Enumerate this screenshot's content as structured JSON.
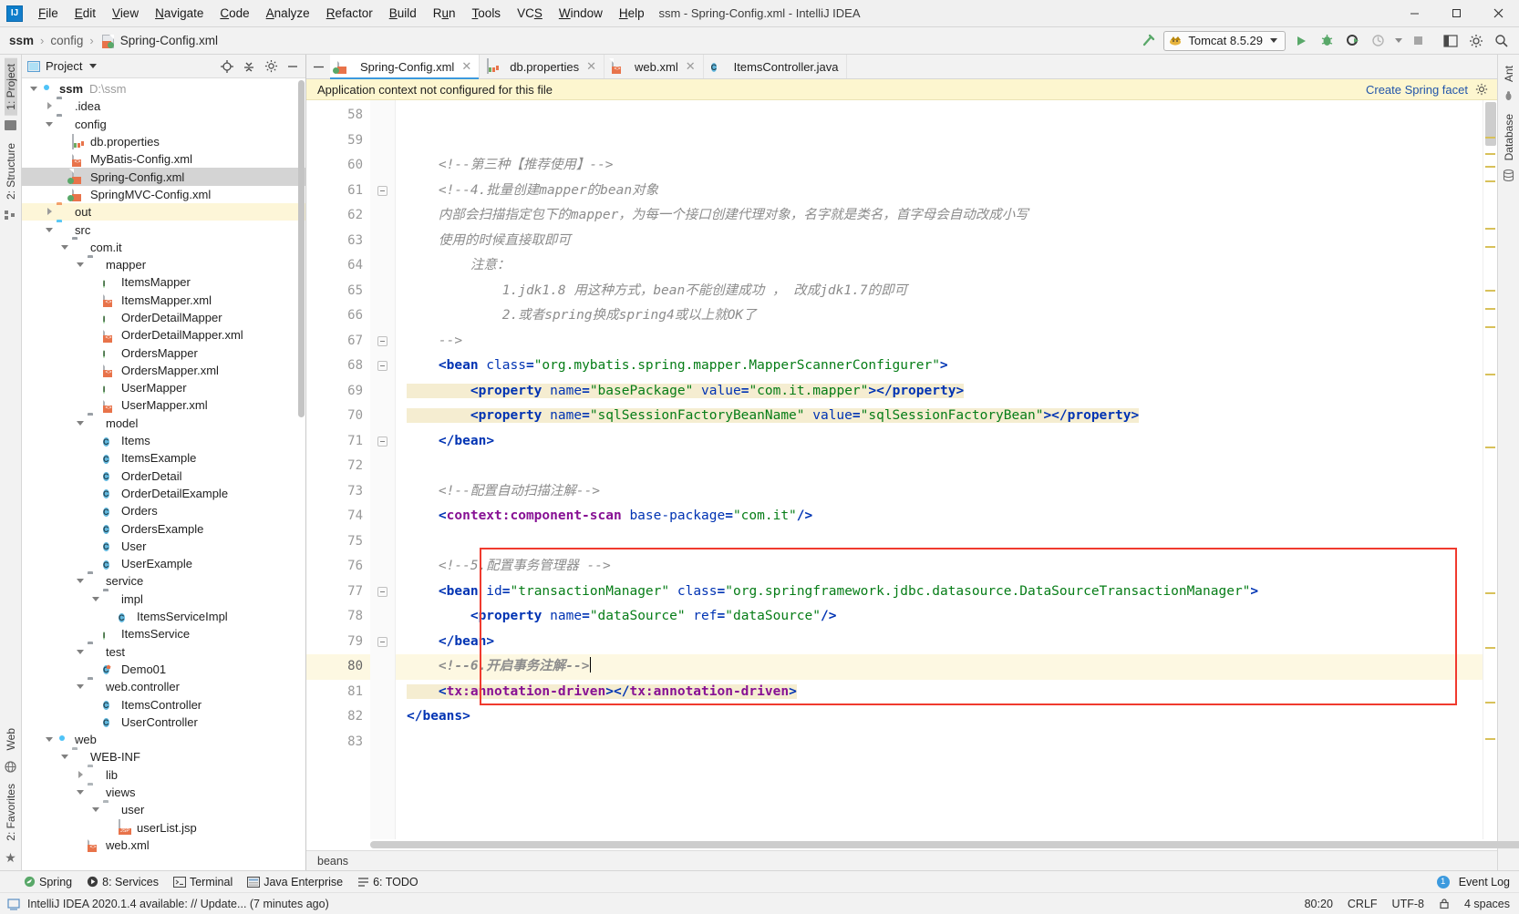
{
  "window": {
    "title": "ssm - Spring-Config.xml - IntelliJ IDEA",
    "logo": "IJ",
    "minimize_label": "─",
    "maximize_label": "☐",
    "close_label": "✕"
  },
  "menu": [
    {
      "label": "File"
    },
    {
      "label": "Edit"
    },
    {
      "label": "View"
    },
    {
      "label": "Navigate"
    },
    {
      "label": "Code"
    },
    {
      "label": "Analyze"
    },
    {
      "label": "Refactor"
    },
    {
      "label": "Build"
    },
    {
      "label": "Run"
    },
    {
      "label": "Tools"
    },
    {
      "label": "VCS"
    },
    {
      "label": "Window"
    },
    {
      "label": "Help"
    }
  ],
  "breadcrumb": {
    "project": "ssm",
    "folder": "config",
    "file": "Spring-Config.xml",
    "separator": "›"
  },
  "toolbar": {
    "build_icon": "hammer-icon",
    "run_config": "Tomcat 8.5.29",
    "run_icon": "run-icon",
    "debug_icon": "debug-icon",
    "run_coverage_icon": "run-with-coverage-icon",
    "profile_icon": "profile-icon",
    "stop_icon": "stop-icon",
    "layout_icon": "layout-icon",
    "settings_icon": "settings-icon",
    "search_icon": "search-icon"
  },
  "left_rail": {
    "top": [
      {
        "label": "1: Project",
        "selected": true
      },
      {
        "label": "2: Structure",
        "selected": false
      }
    ],
    "bottom": [
      {
        "label": "Web"
      },
      {
        "label": "2: Favorites"
      }
    ]
  },
  "right_rail": [
    {
      "label": "Ant"
    },
    {
      "label": "Database"
    }
  ],
  "project_pane": {
    "title": "Project",
    "icons": [
      "locate-icon",
      "collapse-all-icon",
      "settings-gear-icon",
      "hide-icon"
    ],
    "tree": [
      {
        "depth": 0,
        "arrow": "down",
        "icon": "module",
        "label": "ssm",
        "bold": true,
        "path": "D:\\ssm",
        "state": "normal"
      },
      {
        "depth": 1,
        "arrow": "right",
        "icon": "folder",
        "label": ".idea",
        "state": "normal"
      },
      {
        "depth": 1,
        "arrow": "down",
        "icon": "folder",
        "label": "config",
        "state": "normal"
      },
      {
        "depth": 2,
        "arrow": "none",
        "icon": "props",
        "label": "db.properties",
        "state": "normal"
      },
      {
        "depth": 2,
        "arrow": "none",
        "icon": "xml",
        "label": "MyBatis-Config.xml",
        "state": "normal"
      },
      {
        "depth": 2,
        "arrow": "none",
        "icon": "spring",
        "label": "Spring-Config.xml",
        "state": "selected"
      },
      {
        "depth": 2,
        "arrow": "none",
        "icon": "spring",
        "label": "SpringMVC-Config.xml",
        "state": "normal"
      },
      {
        "depth": 1,
        "arrow": "right",
        "icon": "folder-orange",
        "label": "out",
        "state": "highlight"
      },
      {
        "depth": 1,
        "arrow": "down",
        "icon": "folder-blue",
        "label": "src",
        "state": "normal"
      },
      {
        "depth": 2,
        "arrow": "down",
        "icon": "package",
        "label": "com.it",
        "state": "normal"
      },
      {
        "depth": 3,
        "arrow": "down",
        "icon": "package",
        "label": "mapper",
        "state": "normal"
      },
      {
        "depth": 4,
        "arrow": "none",
        "icon": "iface",
        "label": "ItemsMapper",
        "state": "normal"
      },
      {
        "depth": 4,
        "arrow": "none",
        "icon": "xml",
        "label": "ItemsMapper.xml",
        "state": "normal"
      },
      {
        "depth": 4,
        "arrow": "none",
        "icon": "iface",
        "label": "OrderDetailMapper",
        "state": "normal"
      },
      {
        "depth": 4,
        "arrow": "none",
        "icon": "xml",
        "label": "OrderDetailMapper.xml",
        "state": "normal"
      },
      {
        "depth": 4,
        "arrow": "none",
        "icon": "iface",
        "label": "OrdersMapper",
        "state": "normal"
      },
      {
        "depth": 4,
        "arrow": "none",
        "icon": "xml",
        "label": "OrdersMapper.xml",
        "state": "normal"
      },
      {
        "depth": 4,
        "arrow": "none",
        "icon": "iface",
        "label": "UserMapper",
        "state": "normal"
      },
      {
        "depth": 4,
        "arrow": "none",
        "icon": "xml",
        "label": "UserMapper.xml",
        "state": "normal"
      },
      {
        "depth": 3,
        "arrow": "down",
        "icon": "package",
        "label": "model",
        "state": "normal"
      },
      {
        "depth": 4,
        "arrow": "none",
        "icon": "class",
        "label": "Items",
        "state": "normal"
      },
      {
        "depth": 4,
        "arrow": "none",
        "icon": "class",
        "label": "ItemsExample",
        "state": "normal"
      },
      {
        "depth": 4,
        "arrow": "none",
        "icon": "class",
        "label": "OrderDetail",
        "state": "normal"
      },
      {
        "depth": 4,
        "arrow": "none",
        "icon": "class",
        "label": "OrderDetailExample",
        "state": "normal"
      },
      {
        "depth": 4,
        "arrow": "none",
        "icon": "class",
        "label": "Orders",
        "state": "normal"
      },
      {
        "depth": 4,
        "arrow": "none",
        "icon": "class",
        "label": "OrdersExample",
        "state": "normal"
      },
      {
        "depth": 4,
        "arrow": "none",
        "icon": "class",
        "label": "User",
        "state": "normal"
      },
      {
        "depth": 4,
        "arrow": "none",
        "icon": "class",
        "label": "UserExample",
        "state": "normal"
      },
      {
        "depth": 3,
        "arrow": "down",
        "icon": "package",
        "label": "service",
        "state": "normal"
      },
      {
        "depth": 4,
        "arrow": "down",
        "icon": "package",
        "label": "impl",
        "state": "normal"
      },
      {
        "depth": 5,
        "arrow": "none",
        "icon": "class",
        "label": "ItemsServiceImpl",
        "state": "normal"
      },
      {
        "depth": 4,
        "arrow": "none",
        "icon": "iface",
        "label": "ItemsService",
        "state": "normal"
      },
      {
        "depth": 3,
        "arrow": "down",
        "icon": "package",
        "label": "test",
        "state": "normal"
      },
      {
        "depth": 4,
        "arrow": "none",
        "icon": "test",
        "label": "Demo01",
        "state": "normal"
      },
      {
        "depth": 3,
        "arrow": "down",
        "icon": "package",
        "label": "web.controller",
        "state": "normal"
      },
      {
        "depth": 4,
        "arrow": "none",
        "icon": "class",
        "label": "ItemsController",
        "state": "normal"
      },
      {
        "depth": 4,
        "arrow": "none",
        "icon": "class",
        "label": "UserController",
        "state": "normal"
      },
      {
        "depth": 1,
        "arrow": "down",
        "icon": "module",
        "label": "web",
        "state": "normal"
      },
      {
        "depth": 2,
        "arrow": "down",
        "icon": "folder-gray",
        "label": "WEB-INF",
        "state": "normal"
      },
      {
        "depth": 3,
        "arrow": "right",
        "icon": "folder-gray",
        "label": "lib",
        "state": "normal"
      },
      {
        "depth": 3,
        "arrow": "down",
        "icon": "folder-gray",
        "label": "views",
        "state": "normal"
      },
      {
        "depth": 4,
        "arrow": "down",
        "icon": "folder-gray",
        "label": "user",
        "state": "normal"
      },
      {
        "depth": 5,
        "arrow": "none",
        "icon": "jsp",
        "label": "userList.jsp",
        "state": "normal"
      },
      {
        "depth": 3,
        "arrow": "none",
        "icon": "xml",
        "label": "web.xml",
        "state": "normal"
      }
    ]
  },
  "editor": {
    "tabs": [
      {
        "label": "Spring-Config.xml",
        "icon": "spring-xml-icon",
        "active": true,
        "close": "✕"
      },
      {
        "label": "db.properties",
        "icon": "properties-icon",
        "active": false,
        "close": "✕"
      },
      {
        "label": "web.xml",
        "icon": "xml-icon",
        "active": false,
        "close": "✕"
      },
      {
        "label": "ItemsController.java",
        "icon": "class-icon",
        "active": false,
        "close": ""
      }
    ],
    "banner": {
      "message": "Application context not configured for this file",
      "action_label": "Create Spring facet",
      "action_icon": "gear-icon"
    },
    "breadcrumb": "beans",
    "first_line_number": 58,
    "lines": [
      {
        "n": 58,
        "tokens": []
      },
      {
        "n": 59,
        "tokens": []
      },
      {
        "n": 60,
        "tokens": [
          {
            "t": "cmt",
            "s": "    <!--第三种【推荐使用】-->"
          }
        ]
      },
      {
        "n": 61,
        "fold": true,
        "tokens": [
          {
            "t": "cmt",
            "s": "    <!--4.批量创建mapper的bean对象"
          }
        ]
      },
      {
        "n": 62,
        "tokens": [
          {
            "t": "cmt",
            "s": "    内部会扫描指定包下的mapper，为每一个接口创建代理对象，名字就是类名，首字母会自动改成小写"
          }
        ]
      },
      {
        "n": 63,
        "tokens": [
          {
            "t": "cmt",
            "s": "    使用的时候直接取即可"
          }
        ]
      },
      {
        "n": 64,
        "tokens": [
          {
            "t": "cmt",
            "s": "        注意："
          }
        ]
      },
      {
        "n": 65,
        "tokens": [
          {
            "t": "cmt",
            "s": "            1.jdk1.8 用这种方式，bean不能创建成功 ， 改成jdk1.7的即可"
          }
        ]
      },
      {
        "n": 66,
        "tokens": [
          {
            "t": "cmt",
            "s": "            2.或者spring换成spring4或以上就OK了"
          }
        ]
      },
      {
        "n": 67,
        "fold": true,
        "tokens": [
          {
            "t": "cmt",
            "s": "    -->"
          }
        ]
      },
      {
        "n": 68,
        "fold": true,
        "tokens": [
          {
            "t": "punct",
            "s": "    <"
          },
          {
            "t": "tagname",
            "s": "bean"
          },
          {
            "t": "attr",
            "s": " class"
          },
          {
            "t": "punct",
            "s": "="
          },
          {
            "t": "val",
            "s": "\"org.mybatis.spring.mapper.MapperScannerConfigurer\""
          },
          {
            "t": "punct",
            "s": ">"
          }
        ]
      },
      {
        "n": 69,
        "hl": true,
        "tokens": [
          {
            "t": "punct",
            "s": "        <"
          },
          {
            "t": "tagname",
            "s": "property"
          },
          {
            "t": "attr",
            "s": " name"
          },
          {
            "t": "punct",
            "s": "="
          },
          {
            "t": "val",
            "s": "\"basePackage\""
          },
          {
            "t": "attr",
            "s": " value"
          },
          {
            "t": "punct",
            "s": "="
          },
          {
            "t": "val",
            "s": "\"com.it.mapper\""
          },
          {
            "t": "punct",
            "s": "></"
          },
          {
            "t": "tagname",
            "s": "property"
          },
          {
            "t": "punct",
            "s": ">"
          }
        ]
      },
      {
        "n": 70,
        "hl": true,
        "tokens": [
          {
            "t": "punct",
            "s": "        <"
          },
          {
            "t": "tagname",
            "s": "property"
          },
          {
            "t": "attr",
            "s": " name"
          },
          {
            "t": "punct",
            "s": "="
          },
          {
            "t": "val",
            "s": "\"sqlSessionFactoryBeanName\""
          },
          {
            "t": "attr",
            "s": " value"
          },
          {
            "t": "punct",
            "s": "="
          },
          {
            "t": "val",
            "s": "\"sqlSessionFactoryBean\""
          },
          {
            "t": "punct",
            "s": "></"
          },
          {
            "t": "tagname",
            "s": "property"
          },
          {
            "t": "punct",
            "s": ">"
          }
        ]
      },
      {
        "n": 71,
        "fold": true,
        "tokens": [
          {
            "t": "punct",
            "s": "    </"
          },
          {
            "t": "tagname",
            "s": "bean"
          },
          {
            "t": "punct",
            "s": ">"
          }
        ]
      },
      {
        "n": 72,
        "tokens": []
      },
      {
        "n": 73,
        "tokens": [
          {
            "t": "cmt",
            "s": "    <!--配置自动扫描注解-->"
          }
        ]
      },
      {
        "n": 74,
        "gicon": "spring-bean-icon",
        "tokens": [
          {
            "t": "punct",
            "s": "    <"
          },
          {
            "t": "ns",
            "s": "context:component-scan"
          },
          {
            "t": "attr",
            "s": " base-package"
          },
          {
            "t": "punct",
            "s": "="
          },
          {
            "t": "val",
            "s": "\"com.it\""
          },
          {
            "t": "punct",
            "s": "/>"
          }
        ]
      },
      {
        "n": 75,
        "tokens": []
      },
      {
        "n": 76,
        "tokens": [
          {
            "t": "cmt",
            "s": "    <!--5.配置事务管理器 -->"
          }
        ]
      },
      {
        "n": 77,
        "fold": true,
        "tokens": [
          {
            "t": "punct",
            "s": "    <"
          },
          {
            "t": "tagname",
            "s": "bean"
          },
          {
            "t": "attr",
            "s": " id"
          },
          {
            "t": "punct",
            "s": "="
          },
          {
            "t": "val",
            "s": "\"transactionManager\""
          },
          {
            "t": "attr",
            "s": " class"
          },
          {
            "t": "punct",
            "s": "="
          },
          {
            "t": "val",
            "s": "\"org.springframework.jdbc.datasource.DataSourceTransactionManager\""
          },
          {
            "t": "punct",
            "s": ">"
          }
        ]
      },
      {
        "n": 78,
        "tokens": [
          {
            "t": "punct",
            "s": "        <"
          },
          {
            "t": "tagname",
            "s": "property"
          },
          {
            "t": "attr",
            "s": " name"
          },
          {
            "t": "punct",
            "s": "="
          },
          {
            "t": "val",
            "s": "\"dataSource\""
          },
          {
            "t": "attr",
            "s": " ref"
          },
          {
            "t": "punct",
            "s": "="
          },
          {
            "t": "val",
            "s": "\"dataSource\""
          },
          {
            "t": "punct",
            "s": "/>"
          }
        ]
      },
      {
        "n": 79,
        "fold": true,
        "tokens": [
          {
            "t": "punct",
            "s": "    </"
          },
          {
            "t": "tagname",
            "s": "bean"
          },
          {
            "t": "punct",
            "s": ">"
          }
        ]
      },
      {
        "n": 80,
        "current": true,
        "gicon": "intention-bulb-icon",
        "caret": true,
        "tokens": [
          {
            "t": "cmt-b",
            "s": "    <!--6.开启事务注解-->"
          }
        ]
      },
      {
        "n": 81,
        "gicon": "override-marker-icon",
        "hl": true,
        "tokens": [
          {
            "t": "punct",
            "s": "    <"
          },
          {
            "t": "ns",
            "s": "tx:annotation-driven"
          },
          {
            "t": "punct",
            "s": "></"
          },
          {
            "t": "ns",
            "s": "tx:annotation-driven"
          },
          {
            "t": "punct",
            "s": ">"
          }
        ]
      },
      {
        "n": 82,
        "tokens": [
          {
            "t": "punct",
            "s": "</"
          },
          {
            "t": "tagname",
            "s": "beans"
          },
          {
            "t": "punct",
            "s": ">"
          }
        ]
      },
      {
        "n": 83,
        "tokens": []
      }
    ]
  },
  "bottom_toolbar": [
    {
      "label": "Spring",
      "icon": "spring-leaf-icon"
    },
    {
      "label": "8: Services",
      "icon": "services-icon"
    },
    {
      "label": "Terminal",
      "icon": "terminal-icon"
    },
    {
      "label": "Java Enterprise",
      "icon": "java-ee-icon"
    },
    {
      "label": "6: TODO",
      "icon": "todo-icon"
    }
  ],
  "bottom_right": {
    "count": "1",
    "label": "Event Log"
  },
  "status_bar": {
    "message": "IntelliJ IDEA 2020.1.4 available: // Update... (7 minutes ago)",
    "caret_position": "80:20",
    "line_separator": "CRLF",
    "encoding": "UTF-8",
    "indent": "4 spaces",
    "lock_icon": "lock-icon"
  }
}
